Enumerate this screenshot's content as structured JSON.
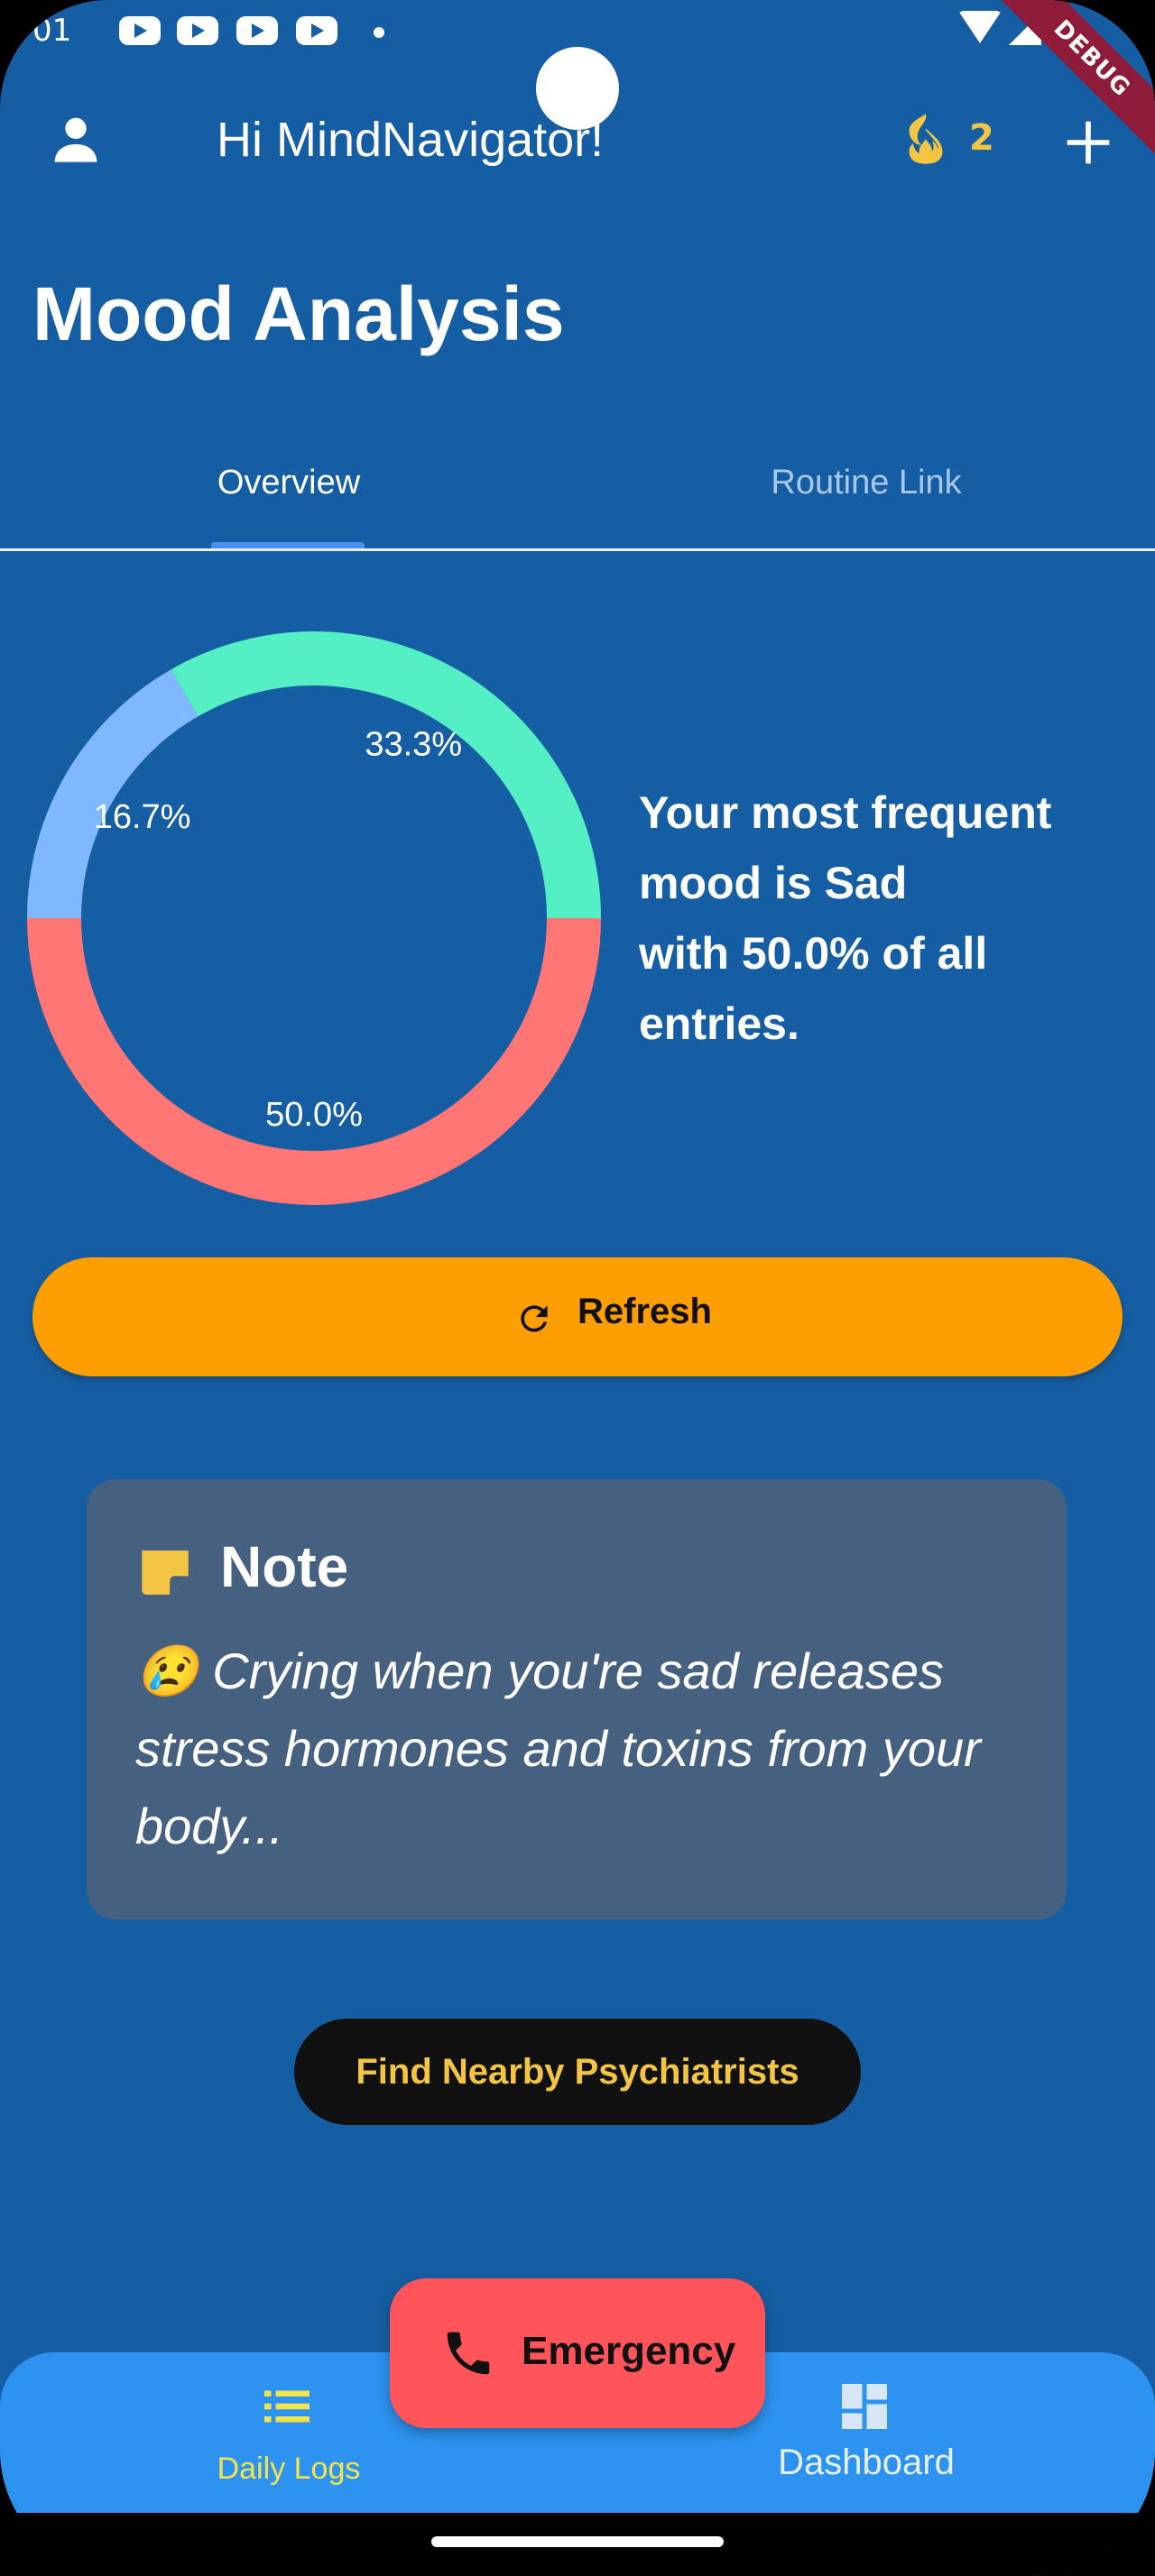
{
  "status_bar": {
    "time": "01"
  },
  "debug_banner": "DEBUG",
  "app_bar": {
    "greeting": "Hi MindNavigator!",
    "streak_count": "2"
  },
  "page": {
    "title": "Mood Analysis"
  },
  "tabs": [
    {
      "label": "Overview",
      "selected": true
    },
    {
      "label": "Routine Link",
      "selected": false
    }
  ],
  "chart_data": {
    "type": "pie",
    "donut": true,
    "slices": [
      {
        "label": "50.0%",
        "value": 50.0,
        "color": "#FF7675"
      },
      {
        "label": "16.7%",
        "value": 16.7,
        "color": "#7FB8FF"
      },
      {
        "label": "33.3%",
        "value": 33.3,
        "color": "#55EFC4"
      }
    ]
  },
  "summary": {
    "line1": "Your most frequent",
    "line2": "mood is Sad",
    "line3": "with 50.0% of all",
    "line4": "entries."
  },
  "refresh": {
    "label": "Refresh"
  },
  "note": {
    "title": "Note",
    "emoji": "😢",
    "text": "Crying when you're sad releases stress hormones and toxins from your body..."
  },
  "find_psychiatrists": {
    "label": "Find Nearby Psychiatrists"
  },
  "emergency": {
    "label": "Emergency"
  },
  "bottom_nav": [
    {
      "label": "Daily Logs",
      "selected": true
    },
    {
      "label": "Dashboard",
      "selected": false
    }
  ],
  "colors": {
    "background": "#165EA3",
    "accent_orange": "#FF9E00",
    "emergency_red": "#FF5459",
    "nav_blue": "#2D93F0"
  }
}
